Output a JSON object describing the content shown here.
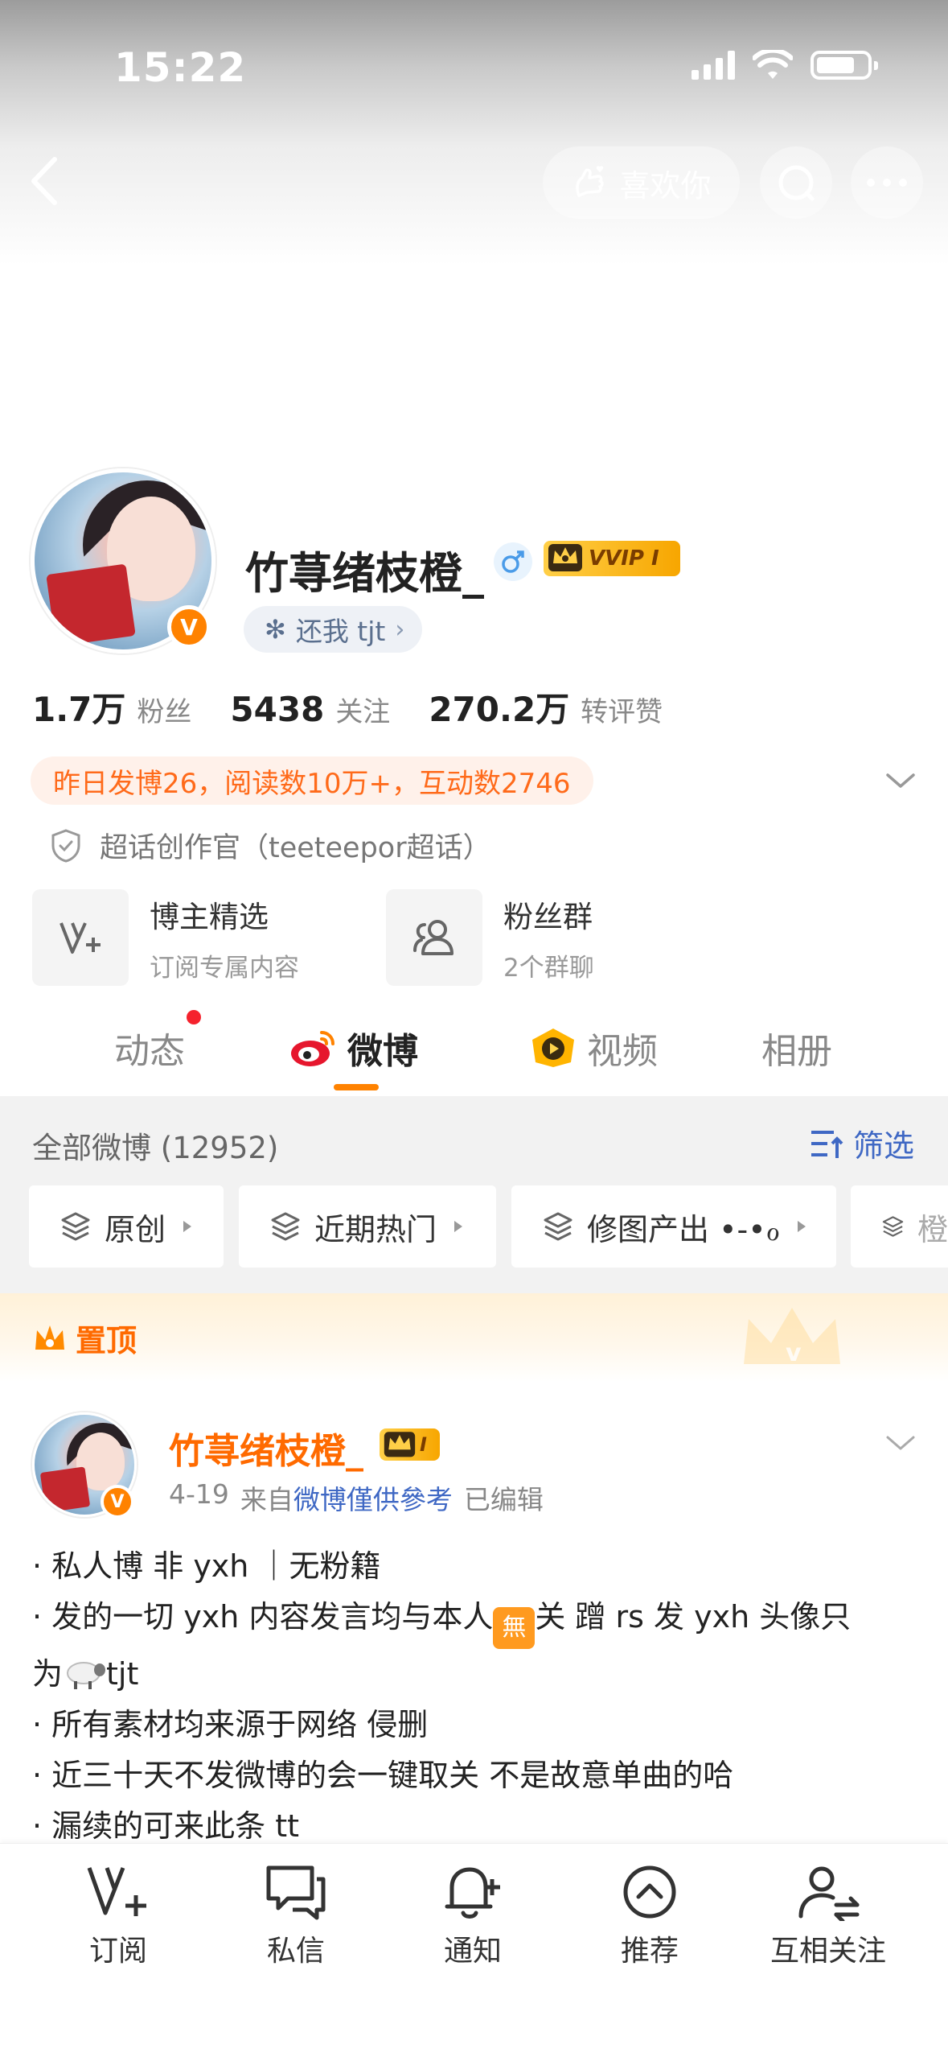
{
  "status_bar": {
    "time": "15:22"
  },
  "header": {
    "like_label": "喜欢你"
  },
  "profile": {
    "name": "竹荨绪枝橙_",
    "vip_label": "VVIP I",
    "tag": "还我 tjt",
    "stats": [
      {
        "num": "1.7万",
        "label": "粉丝"
      },
      {
        "num": "5438",
        "label": "关注"
      },
      {
        "num": "270.2万",
        "label": "转评赞"
      }
    ],
    "notice": "昨日发博26，阅读数10万+，互动数2746",
    "cert": "超话创作官（teeteepor超话）",
    "features": [
      {
        "title": "博主精选",
        "sub": "订阅专属内容"
      },
      {
        "title": "粉丝群",
        "sub": "2个群聊"
      }
    ]
  },
  "tabs": [
    "动态",
    "微博",
    "视频",
    "相册"
  ],
  "weibo_list": {
    "all_label": "全部微博 (12952)",
    "filter_label": "筛选",
    "chips": [
      "原创",
      "近期热门",
      "修图产出 •-•ℴ",
      "橙"
    ]
  },
  "pinned": {
    "label": "置顶",
    "post": {
      "name": "竹荨绪枝橙_",
      "badge": "I",
      "date": "4-19",
      "from_prefix": "来自",
      "source": "微博僅供參考",
      "edited": "已编辑",
      "lines": [
        "· 私人博 非 yxh ｜无粉籍",
        "· 发的一切 yxh 内容发言均与本人",
        "关  蹭 rs 发 yxh 头像只",
        "为",
        "tjt",
        "· 所有素材均来源于网络  侵删",
        "· 近三十天不发微博的会一键取关  不是故意单曲的哈",
        "· 漏续的可来此条 tt"
      ],
      "emoji_text": "無"
    }
  },
  "bottom_nav": [
    "订阅",
    "私信",
    "通知",
    "推荐",
    "互相关注"
  ]
}
